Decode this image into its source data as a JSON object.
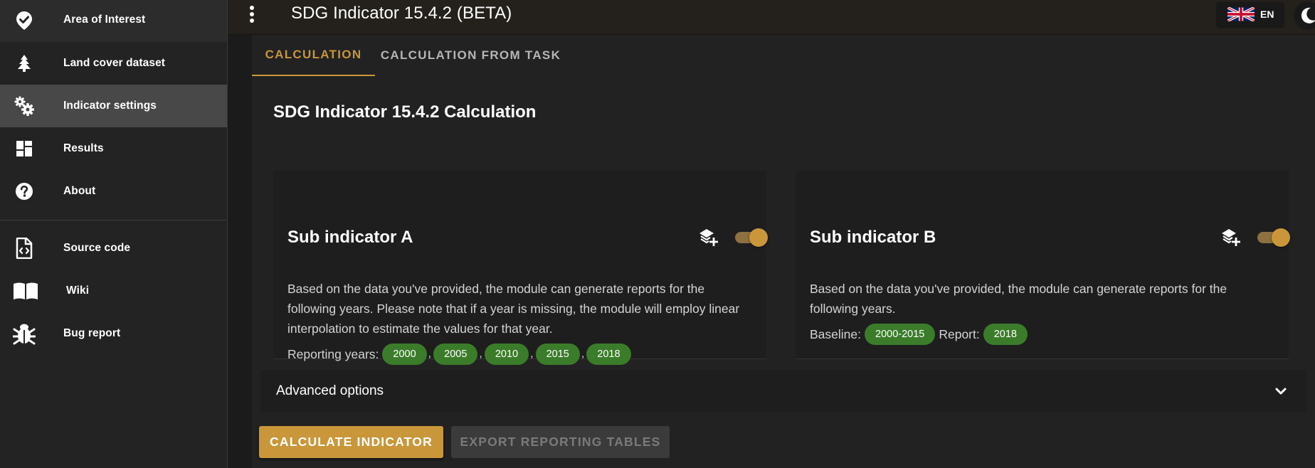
{
  "sidebar": {
    "items": [
      {
        "label": "Area of Interest",
        "icon": "shield-check-icon"
      },
      {
        "label": "Land cover dataset",
        "icon": "tree-icon"
      },
      {
        "label": "Indicator settings",
        "icon": "gears-icon"
      },
      {
        "label": "Results",
        "icon": "dashboard-icon"
      },
      {
        "label": "About",
        "icon": "help-circle-icon"
      },
      {
        "label": "Source code",
        "icon": "code-file-icon"
      },
      {
        "label": "Wiki",
        "icon": "book-icon"
      },
      {
        "label": "Bug report",
        "icon": "bug-icon"
      }
    ],
    "selected": "Indicator settings"
  },
  "topbar": {
    "title": "SDG Indicator 15.4.2 (BETA)",
    "language": "EN"
  },
  "tabs": [
    {
      "label": "CALCULATION",
      "active": true
    },
    {
      "label": "CALCULATION FROM TASK",
      "active": false
    }
  ],
  "main": {
    "title": "SDG Indicator 15.4.2 Calculation",
    "card_a": {
      "title": "Sub indicator A",
      "description": "Based on the data you've provided, the module can generate reports for the following years. Please note that if a year is missing, the module will employ linear interpolation to estimate the values for that year.",
      "reporting_label": "Reporting years:",
      "years": [
        "2000",
        "2005",
        "2010",
        "2015",
        "2018"
      ],
      "enabled": true
    },
    "card_b": {
      "title": "Sub indicator B",
      "description": "Based on the data you've provided, the module can generate reports for the following years.",
      "baseline_label": "Baseline:",
      "baseline_value": "2000-2015",
      "report_label": "Report:",
      "report_value": "2018",
      "enabled": true
    },
    "advanced_label": "Advanced options"
  },
  "buttons": {
    "calculate": "CALCULATE INDICATOR",
    "export": "EXPORT REPORTING TABLES"
  },
  "colors": {
    "accent": "#c9973a",
    "chip": "#3b7c2a",
    "background": "#1b1b1b"
  }
}
